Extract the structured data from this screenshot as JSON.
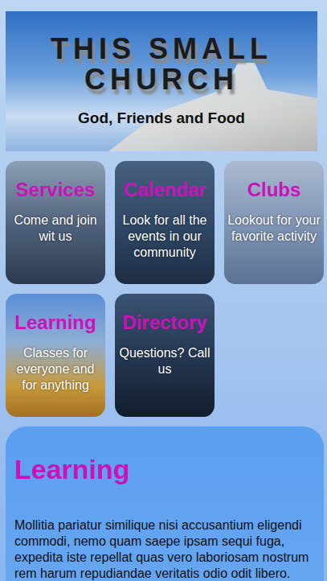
{
  "header": {
    "title": "THIS SMALL CHURCH",
    "tagline": "God, Friends and Food"
  },
  "cards": [
    {
      "title": "Services",
      "text": "Come and join wit us"
    },
    {
      "title": "Calendar",
      "text": "Look for all the events in our community"
    },
    {
      "title": "Clubs",
      "text": "Lookout for your favorite activity"
    },
    {
      "title": "Learning",
      "text": "Classes for everyone and for anything"
    },
    {
      "title": "Directory",
      "text": "Questions? Call us"
    }
  ],
  "section": {
    "heading": "Learning",
    "body": "Mollitia pariatur similique nisi accusantium eligendi commodi, nemo quam saepe ipsam sequi fuga, expedita iste repellat quas vero laboriosam nostrum rem harum repudiandae veritatis odio odit libero."
  }
}
